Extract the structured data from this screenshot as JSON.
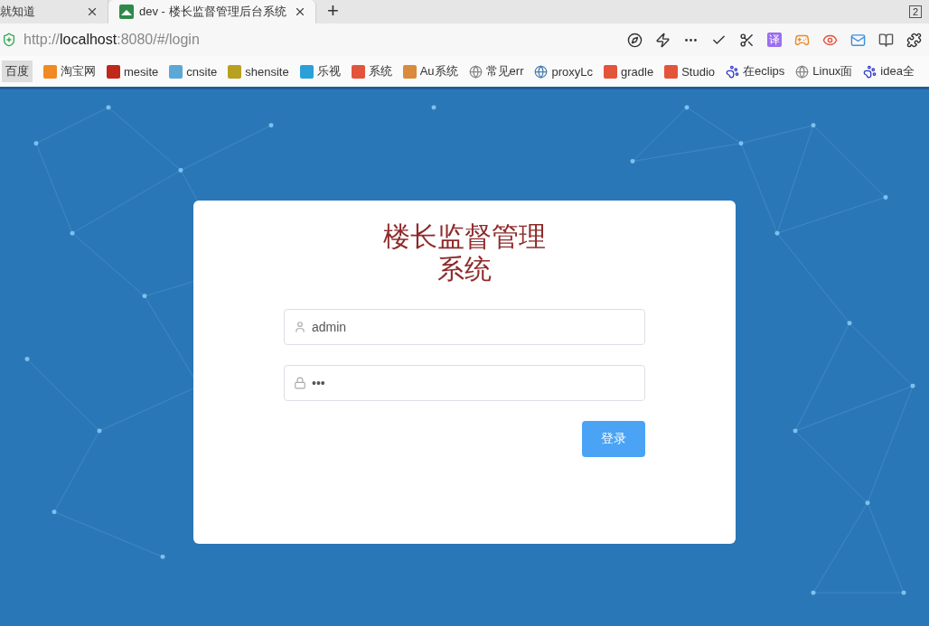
{
  "browser": {
    "tabs": [
      {
        "title": "就知道",
        "selected": false
      },
      {
        "title": "dev - 楼长监督管理后台系统",
        "selected": true
      }
    ],
    "new_tab": "+",
    "tab_count": "2",
    "address": {
      "scheme": "http://",
      "host": "localhost",
      "rest": ":8080/#/login"
    },
    "bookmarks": [
      {
        "label": "百度",
        "kind": "plain",
        "color": "#dddddd"
      },
      {
        "label": "淘宝网",
        "kind": "square",
        "color": "#f08a24"
      },
      {
        "label": "mesite",
        "kind": "square",
        "color": "#c0281c"
      },
      {
        "label": "cnsite",
        "kind": "square",
        "color": "#5ba7d6"
      },
      {
        "label": "shensite",
        "kind": "square",
        "color": "#b8a020"
      },
      {
        "label": "乐视",
        "kind": "square",
        "color": "#2aa0d8"
      },
      {
        "label": "系统",
        "kind": "square",
        "color": "#e2553b"
      },
      {
        "label": "Au系统",
        "kind": "square",
        "color": "#d98a3c"
      },
      {
        "label": "常见err",
        "kind": "globe",
        "color": "#888888"
      },
      {
        "label": "proxyLc",
        "kind": "globe",
        "color": "#4a7fb0"
      },
      {
        "label": "gradle",
        "kind": "square",
        "color": "#e2553b"
      },
      {
        "label": "Studio",
        "kind": "square",
        "color": "#e2553b"
      },
      {
        "label": "在eclips",
        "kind": "paw",
        "color": "#2932c8"
      },
      {
        "label": "Linux面",
        "kind": "globe",
        "color": "#888888"
      },
      {
        "label": "idea全",
        "kind": "paw",
        "color": "#2932c8"
      }
    ],
    "translate_label": "译"
  },
  "login": {
    "title": "楼长监督管理系统",
    "username": {
      "value": "admin"
    },
    "password": {
      "value": "•••"
    },
    "submit": "登录"
  }
}
